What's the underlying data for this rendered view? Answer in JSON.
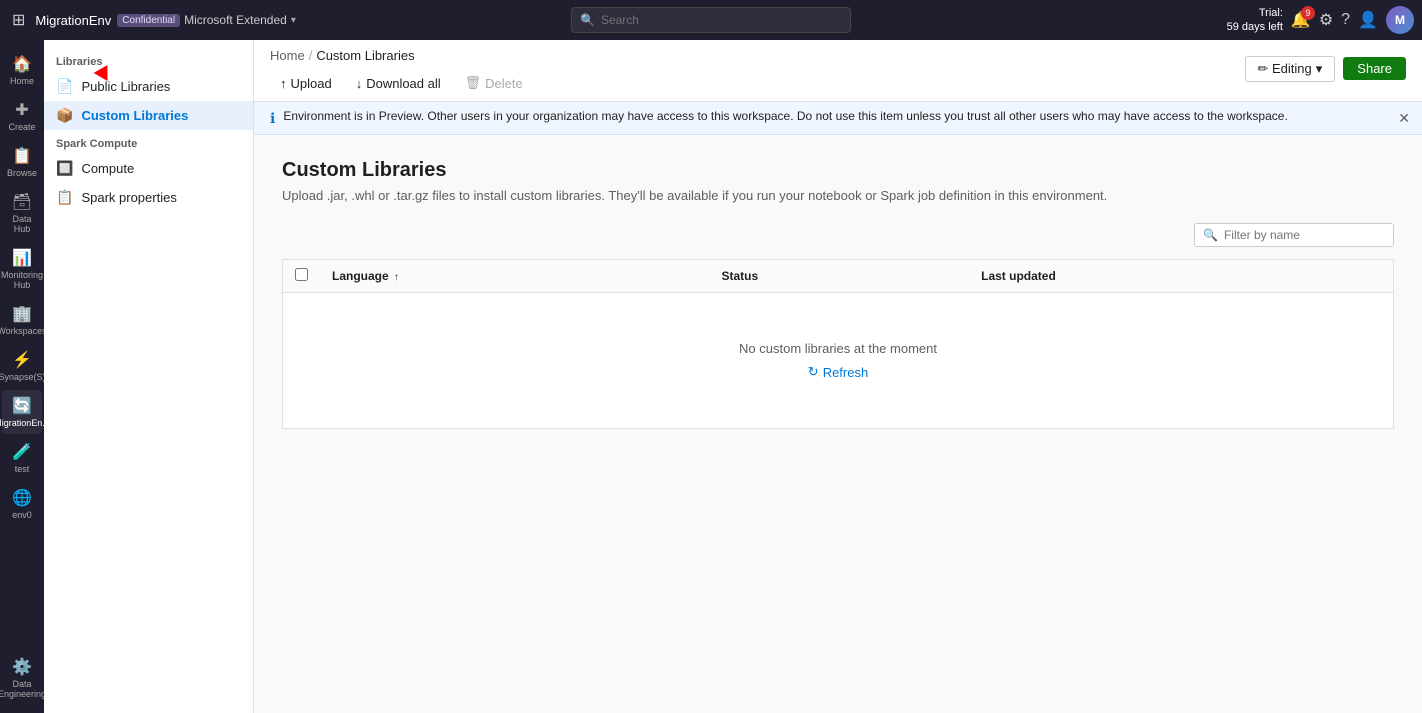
{
  "topbar": {
    "waffle_icon": "⊞",
    "app_name": "MigrationEnv",
    "env_badge": "Confidential",
    "env_extended": "Microsoft Extended",
    "chevron": "▾",
    "search_placeholder": "Search",
    "trial_line1": "Trial:",
    "trial_line2": "59 days left",
    "notif_count": "9",
    "avatar_initials": "M"
  },
  "left_nav": {
    "items": [
      {
        "id": "home",
        "icon": "🏠",
        "label": "Home"
      },
      {
        "id": "create",
        "icon": "✚",
        "label": "Create"
      },
      {
        "id": "browse",
        "icon": "📋",
        "label": "Browse"
      },
      {
        "id": "datahub",
        "icon": "🗄️",
        "label": "Data Hub"
      },
      {
        "id": "monitoring",
        "icon": "📊",
        "label": "Monitoring Hub"
      },
      {
        "id": "workspaces",
        "icon": "🏢",
        "label": "Workspaces"
      },
      {
        "id": "synapse",
        "icon": "⚡",
        "label": "Synapse(S)"
      },
      {
        "id": "migration",
        "icon": "🔄",
        "label": "MigrationEn..."
      },
      {
        "id": "test",
        "icon": "🧪",
        "label": "test"
      },
      {
        "id": "env0",
        "icon": "🌐",
        "label": "env0"
      }
    ],
    "bottom": [
      {
        "id": "data-engineering",
        "icon": "⚙️",
        "label": "Data Engineering"
      }
    ]
  },
  "sidebar": {
    "section_libraries": "Libraries",
    "item_public": "Public Libraries",
    "item_custom": "Custom Libraries",
    "section_compute": "Spark Compute",
    "item_compute": "Compute",
    "item_spark_props": "Spark properties"
  },
  "breadcrumb": {
    "home": "Home",
    "sep": "/",
    "current": "Custom Libraries"
  },
  "toolbar": {
    "upload_label": "Upload",
    "download_label": "Download all",
    "delete_label": "Delete",
    "upload_icon": "↑",
    "download_icon": "↓",
    "delete_icon": "🗑"
  },
  "top_actions": {
    "editing_label": "✏ Editing",
    "editing_chevron": "▾",
    "share_label": "Share"
  },
  "banner": {
    "icon": "ℹ",
    "text": "Environment is in Preview. Other users in your organization may have access to this workspace. Do not use this item unless you trust all other users who may have access to the workspace.",
    "close_icon": "✕"
  },
  "main": {
    "title": "Custom Libraries",
    "subtitle": "Upload .jar, .whl or .tar.gz files to install custom libraries. They'll be available if you run your notebook or Spark job definition in this environment.",
    "filter_placeholder": "Filter by name",
    "table_headers": [
      {
        "id": "language",
        "label": "Language",
        "sort": "↑"
      },
      {
        "id": "status",
        "label": "Status"
      },
      {
        "id": "last_updated",
        "label": "Last updated"
      }
    ],
    "empty_text": "No custom libraries at the moment",
    "refresh_icon": "↻",
    "refresh_label": "Refresh"
  }
}
